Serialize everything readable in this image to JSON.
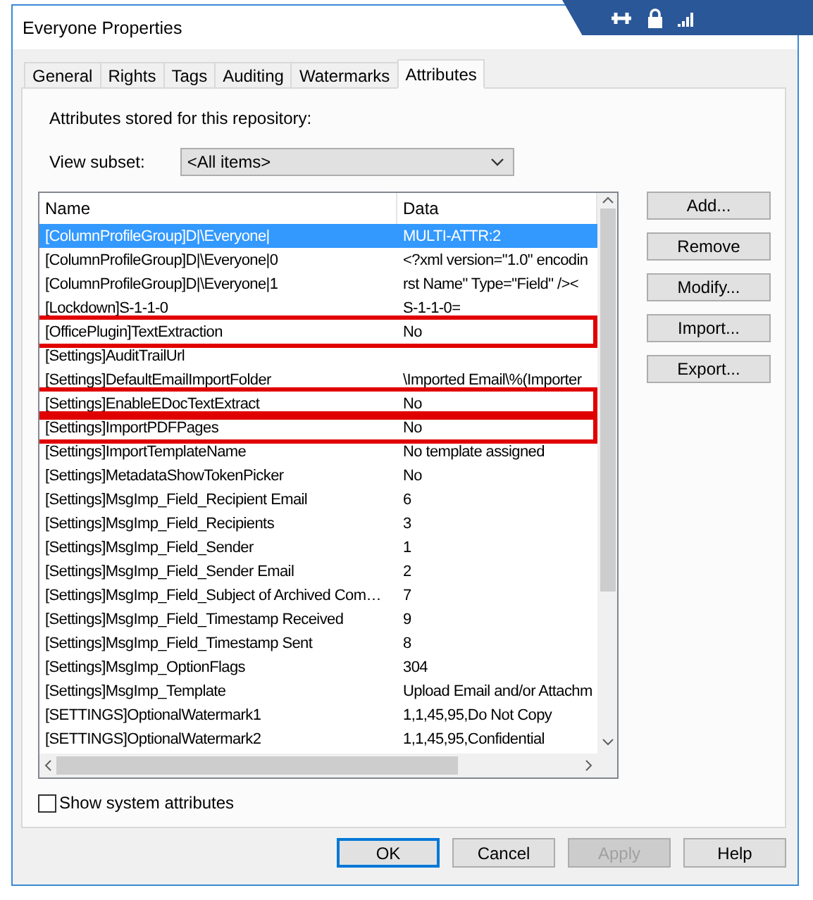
{
  "window": {
    "title": "Everyone Properties"
  },
  "tabs": [
    {
      "label": "General",
      "selected": false
    },
    {
      "label": "Rights",
      "selected": false
    },
    {
      "label": "Tags",
      "selected": false
    },
    {
      "label": "Auditing",
      "selected": false
    },
    {
      "label": "Watermarks",
      "selected": false
    },
    {
      "label": "Attributes",
      "selected": true
    }
  ],
  "description": "Attributes stored for this repository:",
  "view_subset": {
    "label": "View subset:",
    "value": "<All items>"
  },
  "table": {
    "columns": [
      "Name",
      "Data"
    ],
    "rows": [
      {
        "name": "[ColumnProfileGroup]D|\\Everyone|",
        "data": "MULTI-ATTR:2",
        "selected": true,
        "highlighted": false
      },
      {
        "name": "[ColumnProfileGroup]D|\\Everyone|0",
        "data": "<?xml version=\"1.0\" encodin",
        "selected": false,
        "highlighted": false
      },
      {
        "name": "[ColumnProfileGroup]D|\\Everyone|1",
        "data": "rst Name\" Type=\"Field\" /><",
        "selected": false,
        "highlighted": false
      },
      {
        "name": "[Lockdown]S-1-1-0",
        "data": "S-1-1-0=",
        "selected": false,
        "highlighted": false
      },
      {
        "name": "[OfficePlugin]TextExtraction",
        "data": "No",
        "selected": false,
        "highlighted": true
      },
      {
        "name": "[Settings]AuditTrailUrl",
        "selected": false,
        "highlighted": false
      },
      {
        "name": "[Settings]DefaultEmailImportFolder",
        "data": "\\Imported Email\\%(Importer",
        "selected": false,
        "highlighted": false
      },
      {
        "name": "[Settings]EnableEDocTextExtract",
        "data": "No",
        "selected": false,
        "highlighted": true
      },
      {
        "name": "[Settings]ImportPDFPages",
        "data": "No",
        "selected": false,
        "highlighted": true
      },
      {
        "name": "[Settings]ImportTemplateName",
        "data": "No template assigned",
        "selected": false,
        "highlighted": false
      },
      {
        "name": "[Settings]MetadataShowTokenPicker",
        "data": "No",
        "selected": false,
        "highlighted": false
      },
      {
        "name": "[Settings]MsgImp_Field_Recipient Email",
        "data": "6",
        "selected": false,
        "highlighted": false
      },
      {
        "name": "[Settings]MsgImp_Field_Recipients",
        "data": "3",
        "selected": false,
        "highlighted": false
      },
      {
        "name": "[Settings]MsgImp_Field_Sender",
        "data": "1",
        "selected": false,
        "highlighted": false
      },
      {
        "name": "[Settings]MsgImp_Field_Sender Email",
        "data": "2",
        "selected": false,
        "highlighted": false
      },
      {
        "name": "[Settings]MsgImp_Field_Subject of Archived Com…",
        "data": "7",
        "selected": false,
        "highlighted": false
      },
      {
        "name": "[Settings]MsgImp_Field_Timestamp Received",
        "data": "9",
        "selected": false,
        "highlighted": false
      },
      {
        "name": "[Settings]MsgImp_Field_Timestamp Sent",
        "data": "8",
        "selected": false,
        "highlighted": false
      },
      {
        "name": "[Settings]MsgImp_OptionFlags",
        "data": "304",
        "selected": false,
        "highlighted": false
      },
      {
        "name": "[Settings]MsgImp_Template",
        "data": "Upload Email and/or Attachm",
        "selected": false,
        "highlighted": false
      },
      {
        "name": "[SETTINGS]OptionalWatermark1",
        "data": "1,1,45,95,Do Not Copy",
        "selected": false,
        "highlighted": false
      },
      {
        "name": "[SETTINGS]OptionalWatermark2",
        "data": "1,1,45,95,Confidential",
        "selected": false,
        "highlighted": false
      }
    ]
  },
  "side_buttons": [
    {
      "label": "Add..."
    },
    {
      "label": "Remove"
    },
    {
      "label": "Modify..."
    },
    {
      "label": "Import..."
    },
    {
      "label": "Export..."
    }
  ],
  "show_system_attributes": {
    "label": "Show system attributes",
    "checked": false
  },
  "buttons": [
    {
      "label": "OK",
      "default": true,
      "disabled": false
    },
    {
      "label": "Cancel",
      "default": false,
      "disabled": false
    },
    {
      "label": "Apply",
      "default": false,
      "disabled": true
    },
    {
      "label": "Help",
      "default": false,
      "disabled": false
    }
  ]
}
